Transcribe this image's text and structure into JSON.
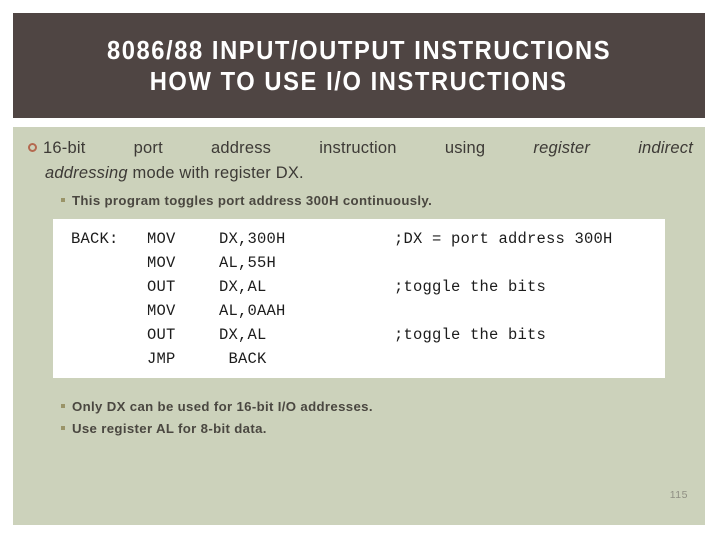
{
  "slide": {
    "page_number": "115",
    "colors": {
      "title_band": "#4f4543",
      "body_panel": "#ccd2bb",
      "title_text": "#ffffff",
      "body_text": "#3d3a36",
      "ring_bullet": "#b4694f",
      "square_bullet": "#9a9468",
      "code_background": "#ffffff",
      "code_text": "#1c1c1c",
      "page_number": "#8f8f83"
    }
  },
  "title": {
    "line1": "8086/88 INPUT/OUTPUT INSTRUCTIONS",
    "line2": "HOW TO USE I/O INSTRUCTIONS"
  },
  "content": {
    "bullet1": {
      "bullet_icon": "circle-outline-bullet-icon",
      "line1_pre": "16-bit   port   address   instruction   using",
      "line1_italic": "register   indirect",
      "line2_italic": "addressing",
      "line2_post": " mode with register DX."
    },
    "subbullet_top": {
      "bullet_icon": "square-bullet-icon",
      "text": "This program toggles port address 300H continuously."
    },
    "notes": [
      {
        "bullet_icon": "square-bullet-icon",
        "text": "Only DX can be used for 16-bit I/O addresses."
      },
      {
        "bullet_icon": "square-bullet-icon",
        "text": "Use register AL for 8-bit data."
      }
    ]
  },
  "code": {
    "rows": [
      {
        "label": "BACK:",
        "mnemonic": "MOV",
        "operands": "DX,300H",
        "comment": ";DX = port address 300H"
      },
      {
        "label": "",
        "mnemonic": "MOV",
        "operands": "AL,55H",
        "comment": ""
      },
      {
        "label": "",
        "mnemonic": "OUT",
        "operands": "DX,AL",
        "comment": ";toggle the bits"
      },
      {
        "label": "",
        "mnemonic": "MOV",
        "operands": "AL,0AAH",
        "comment": ""
      },
      {
        "label": "",
        "mnemonic": "OUT",
        "operands": "DX,AL",
        "comment": ";toggle the bits"
      },
      {
        "label": "",
        "mnemonic": "JMP",
        "operands": " BACK",
        "comment": ""
      }
    ]
  }
}
